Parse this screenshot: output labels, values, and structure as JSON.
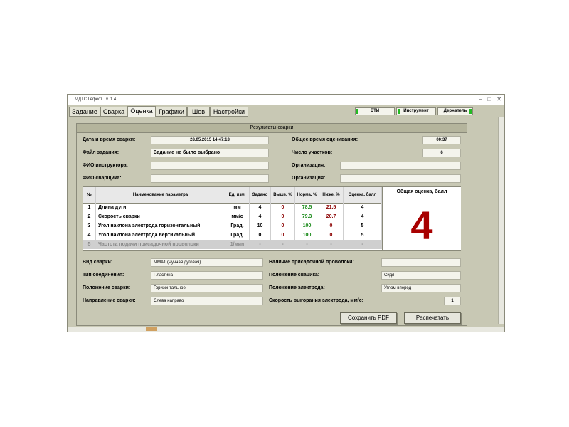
{
  "window": {
    "title": "МДТС Гефест",
    "version": "v. 1.4"
  },
  "tabs": [
    "Задание",
    "Сварка",
    "Оценка",
    "Графики",
    "Шов",
    "Настройки"
  ],
  "active_tab": "Оценка",
  "indicators": [
    "БТИ",
    "Инструмент",
    "Держатель"
  ],
  "panel_title": "Результаты сварки",
  "info": {
    "date_label": "Дата и время сварки:",
    "date_value": "28.05.2015 14:47:13",
    "total_time_label": "Общее время оценивания:",
    "total_time_value": "00:37",
    "task_file_label": "Файл задания:",
    "task_file_value": "Задание не было выбрано",
    "segments_label": "Число участков:",
    "segments_value": "6",
    "instructor_label": "ФИО инструктора:",
    "instructor_value": "",
    "org1_label": "Организация:",
    "org1_value": "",
    "welder_label": "ФИО сварщика:",
    "welder_value": "",
    "org2_label": "Организация:",
    "org2_value": ""
  },
  "table": {
    "headers": [
      "№",
      "Наименование параметра",
      "Ед. изм.",
      "Задано",
      "Выше, %",
      "Норма, %",
      "Ниже, %",
      "Оценка, балл"
    ],
    "rows": [
      {
        "n": "1",
        "name": "Длина дуги",
        "unit": "мм",
        "set": "4",
        "above": "0",
        "norm": "78.5",
        "below": "21.5",
        "score": "4"
      },
      {
        "n": "2",
        "name": "Скорость сварки",
        "unit": "мм/с",
        "set": "4",
        "above": "0",
        "norm": "79.3",
        "below": "20.7",
        "score": "4"
      },
      {
        "n": "3",
        "name": "Угол наклона электрода горизонтальный",
        "unit": "Град.",
        "set": "10",
        "above": "0",
        "norm": "100",
        "below": "0",
        "score": "5"
      },
      {
        "n": "4",
        "name": "Угол наклона электрода вертикальный",
        "unit": "Град.",
        "set": "0",
        "above": "0",
        "norm": "100",
        "below": "0",
        "score": "5"
      },
      {
        "n": "5",
        "name": "Частота подачи присадочной проволоки",
        "unit": "1/мин",
        "set": "-",
        "above": "-",
        "norm": "-",
        "below": "-",
        "score": "-"
      }
    ],
    "overall_label": "Общая оценка, балл",
    "overall_value": "4"
  },
  "details": {
    "weld_type_label": "Вид сварки:",
    "weld_type_value": "MMA1 (Ручная дуговая)",
    "filler_label": "Наличие присадочной проволоки:",
    "filler_value": "",
    "joint_label": "Тип соединения:",
    "joint_value": "Пластина",
    "welder_pos_label": "Положение свацика:",
    "welder_pos_value": "Сидя",
    "weld_pos_label": "Положение сварки:",
    "weld_pos_value": "Горизонтальное",
    "electrode_pos_label": "Положение электрода:",
    "electrode_pos_value": "Углом вперед",
    "direction_label": "Направление сварки:",
    "direction_value": "Слева направо",
    "burn_rate_label": "Скорость выгорания электрода, мм/с:",
    "burn_rate_value": "1"
  },
  "buttons": {
    "save_pdf": "Сохранить PDF",
    "print": "Распечатать"
  },
  "colors": {
    "window_bg": "#c8c8b4",
    "score_red": "#a80000",
    "norm_green": "#1a8a1a",
    "below_red": "#8b0000",
    "led_green": "#22bb22"
  }
}
